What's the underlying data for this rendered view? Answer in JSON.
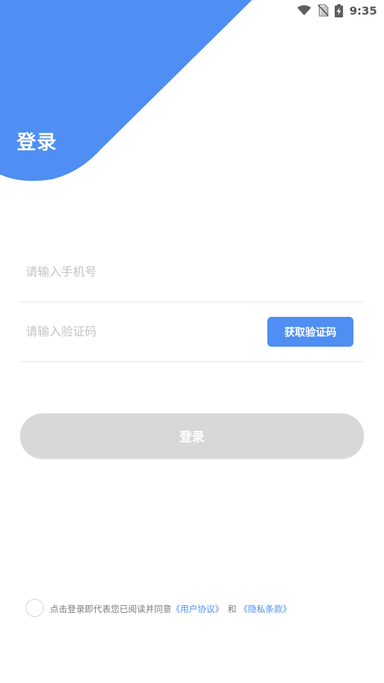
{
  "status_bar": {
    "time": "9:35",
    "icons": [
      "wifi-icon",
      "no-sim-icon",
      "battery-charging-icon"
    ]
  },
  "header": {
    "title": "登录"
  },
  "form": {
    "phone_placeholder": "请输入手机号",
    "code_placeholder": "请输入验证码",
    "get_code_label": "获取验证码",
    "login_label": "登录"
  },
  "agreement": {
    "prefix": "点击登录即代表您已阅读并同意",
    "user_agreement": "《用户协议》",
    "and": "和",
    "privacy_terms": "《隐私条款》"
  },
  "colors": {
    "accent": "#4f8ef2",
    "disabled_button": "#d8d8d8"
  }
}
